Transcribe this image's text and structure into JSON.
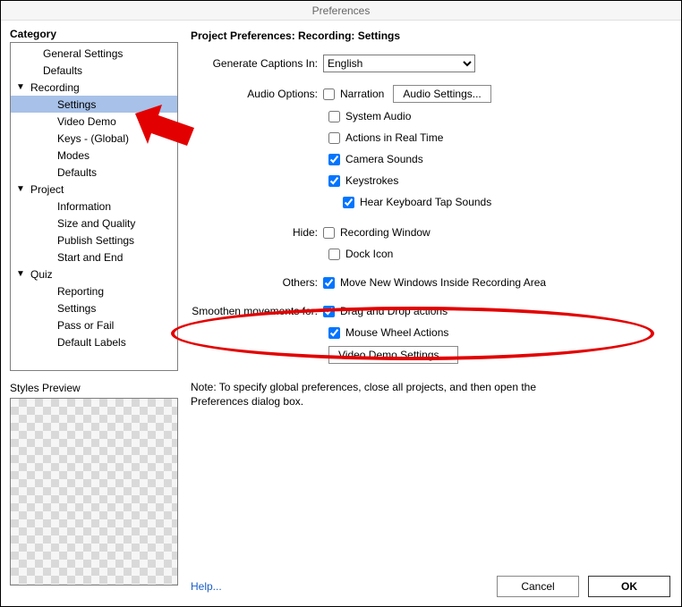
{
  "window": {
    "title": "Preferences"
  },
  "sidebar": {
    "header": "Category",
    "items": [
      {
        "label": "General Settings",
        "indent": 1,
        "arrow": ""
      },
      {
        "label": "Defaults",
        "indent": 1,
        "arrow": ""
      },
      {
        "label": "Recording",
        "indent": 0,
        "arrow": "down"
      },
      {
        "label": "Settings",
        "indent": 2,
        "arrow": "",
        "selected": true
      },
      {
        "label": "Video Demo",
        "indent": 2,
        "arrow": ""
      },
      {
        "label": "Keys - (Global)",
        "indent": 2,
        "arrow": ""
      },
      {
        "label": "Modes",
        "indent": 2,
        "arrow": ""
      },
      {
        "label": "Defaults",
        "indent": 2,
        "arrow": ""
      },
      {
        "label": "Project",
        "indent": 0,
        "arrow": "down"
      },
      {
        "label": "Information",
        "indent": 2,
        "arrow": ""
      },
      {
        "label": "Size and Quality",
        "indent": 2,
        "arrow": ""
      },
      {
        "label": "Publish Settings",
        "indent": 2,
        "arrow": ""
      },
      {
        "label": "Start and End",
        "indent": 2,
        "arrow": ""
      },
      {
        "label": "Quiz",
        "indent": 0,
        "arrow": "down"
      },
      {
        "label": "Reporting",
        "indent": 2,
        "arrow": ""
      },
      {
        "label": "Settings",
        "indent": 2,
        "arrow": ""
      },
      {
        "label": "Pass or Fail",
        "indent": 2,
        "arrow": ""
      },
      {
        "label": "Default Labels",
        "indent": 2,
        "arrow": ""
      }
    ],
    "styles_preview_label": "Styles Preview"
  },
  "main": {
    "heading": "Project Preferences: Recording: Settings",
    "labels": {
      "generate_captions": "Generate Captions In:",
      "audio_options": "Audio Options:",
      "hide": "Hide:",
      "others": "Others:",
      "smoothen": "Smoothen movements for:"
    },
    "captions_selected": "English",
    "checkboxes": {
      "narration": {
        "label": "Narration",
        "checked": false
      },
      "system_audio": {
        "label": "System Audio",
        "checked": false
      },
      "actions_realtime": {
        "label": "Actions in Real Time",
        "checked": false
      },
      "camera_sounds": {
        "label": "Camera Sounds",
        "checked": true
      },
      "keystrokes": {
        "label": "Keystrokes",
        "checked": true
      },
      "hear_tap": {
        "label": "Hear Keyboard Tap Sounds",
        "checked": true
      },
      "recording_window": {
        "label": "Recording Window",
        "checked": false
      },
      "dock_icon": {
        "label": "Dock Icon",
        "checked": false
      },
      "move_new_windows": {
        "label": "Move New Windows Inside Recording Area",
        "checked": true
      },
      "drag_drop": {
        "label": "Drag and Drop actions",
        "checked": true
      },
      "mouse_wheel": {
        "label": "Mouse Wheel Actions",
        "checked": true
      }
    },
    "buttons": {
      "audio_settings": "Audio Settings...",
      "video_demo": "Video Demo Settings..."
    },
    "note": "Note: To specify global preferences, close all projects, and then open the Preferences dialog box."
  },
  "footer": {
    "help": "Help...",
    "cancel": "Cancel",
    "ok": "OK"
  },
  "annotations": {
    "arrow_color": "#e30000",
    "ellipse_color": "#e30000"
  }
}
